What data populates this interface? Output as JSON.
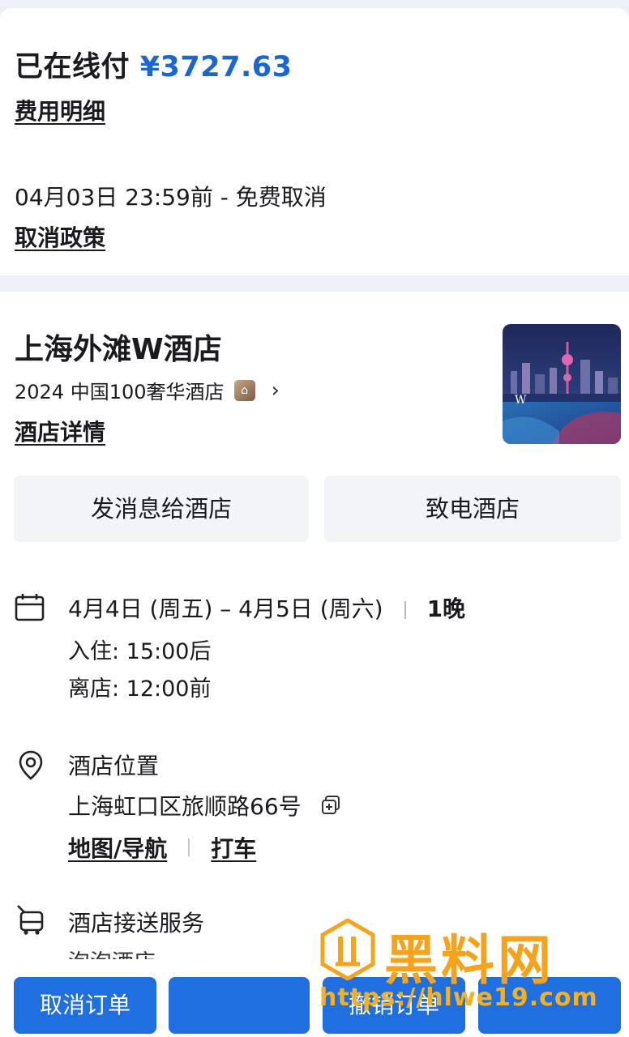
{
  "payment": {
    "paid_label": "已在线付",
    "amount": "¥3727.63",
    "fee_detail_link": "费用明细",
    "cancel_deadline": "04月03日 23:59前 - 免费取消",
    "policy_link": "取消政策"
  },
  "hotel": {
    "name": "上海外滩W酒店",
    "award": "2024 中国100奢华酒店",
    "detail_link": "酒店详情",
    "message_button": "发消息给酒店",
    "call_button": "致电酒店"
  },
  "stay": {
    "dates": "4月4日 (周五) – 4月5日 (周六)",
    "nights": "1晚",
    "checkin": "入住:  15:00后",
    "checkout": "离店:  12:00前"
  },
  "location": {
    "title": "酒店位置",
    "address": "上海虹口区旅顺路66号",
    "map_link": "地图/导航",
    "taxi_link": "打车"
  },
  "shuttle": {
    "title": "酒店接送服务",
    "partial_text": "泡泡酒店"
  },
  "bottom_bar": {
    "cancel_order": "取消订单",
    "button2": "",
    "button3": "撤销订单",
    "button4": ""
  },
  "watermark": {
    "title": "黑料网",
    "url": "https://hlwe19.com"
  },
  "colors": {
    "accent": "#1a67d2",
    "primary_button": "#1f6fe0",
    "watermark": "#f5a31a"
  }
}
